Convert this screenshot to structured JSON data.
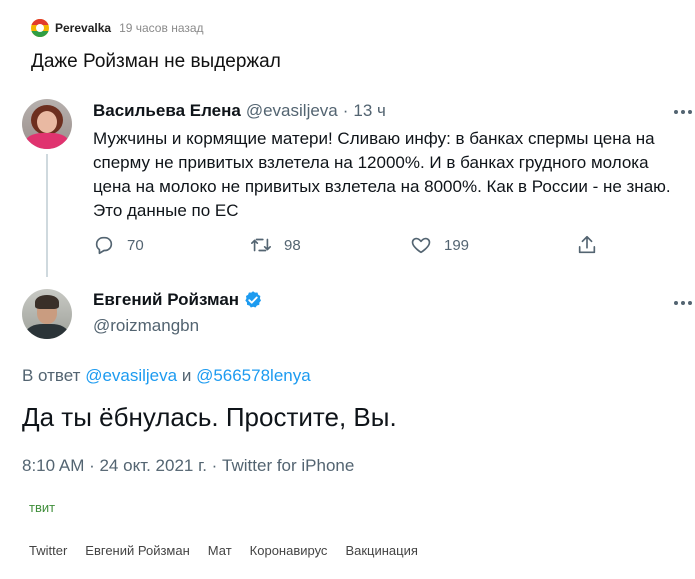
{
  "post": {
    "community": "Perevalka",
    "time": "19 часов назад",
    "title": "Даже Ройзман не выдержал"
  },
  "tweet1": {
    "name": "Васильева Елена",
    "handle": "@evasiljeva",
    "separator": "·",
    "time": "13 ч",
    "text": "Мужчины и кормящие матери! Сливаю инфу: в банках спермы цена на сперму не привитых взлетела на 12000%. И в банках грудного молока цена на молоко не привитых взлетела на 8000%. Как в России - не знаю. Это данные по ЕС",
    "replies": "70",
    "retweets": "98",
    "likes": "199"
  },
  "tweet2": {
    "name": "Евгений Ройзман",
    "handle": "@roizmangbn",
    "reply_prefix": "В ответ",
    "mention1": "@evasiljeva",
    "and": "и",
    "mention2": "@566578lenya",
    "text": "Да ты ёбнулась. Простите, Вы.",
    "meta": "8:10 AM · 24 окт. 2021 г. · Twitter for iPhone"
  },
  "label": "твит",
  "tags": [
    "Twitter",
    "Евгений Ройзман",
    "Мат",
    "Коронавирус",
    "Вакцинация"
  ],
  "colors": {
    "link": "#1d9bf0",
    "verified": "#1d9bf0",
    "label_green": "#3f8e3a"
  },
  "icons": [
    "reply-icon",
    "retweet-icon",
    "like-icon",
    "share-icon",
    "more-icon",
    "verified-icon"
  ]
}
